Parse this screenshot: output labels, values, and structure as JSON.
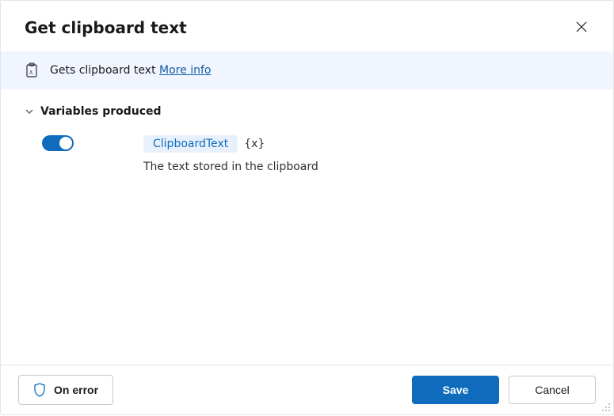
{
  "header": {
    "title": "Get clipboard text"
  },
  "banner": {
    "text": "Gets clipboard text",
    "link_label": "More info"
  },
  "section": {
    "title": "Variables produced"
  },
  "variable": {
    "enabled": true,
    "name": "ClipboardText",
    "braces": "{x}",
    "description": "The text stored in the clipboard"
  },
  "footer": {
    "on_error": "On error",
    "save": "Save",
    "cancel": "Cancel"
  },
  "colors": {
    "accent": "#0f6cbd",
    "banner_bg": "#f0f5ff"
  }
}
